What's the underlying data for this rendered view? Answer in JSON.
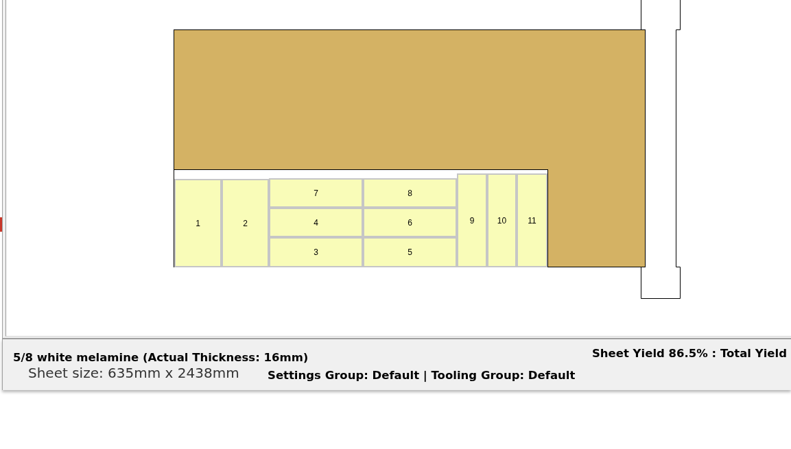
{
  "nesting_view": {
    "sheet": {
      "parts": [
        {
          "label": "1"
        },
        {
          "label": "2"
        },
        {
          "label": "7"
        },
        {
          "label": "4"
        },
        {
          "label": "3"
        },
        {
          "label": "8"
        },
        {
          "label": "6"
        },
        {
          "label": "5"
        },
        {
          "label": "9"
        },
        {
          "label": "10"
        },
        {
          "label": "11"
        }
      ]
    }
  },
  "status_bar": {
    "material": "5/8 white melamine (Actual Thickness: 16mm)",
    "yield": "Sheet Yield 86.5% : Total Yield",
    "sheet_size": "Sheet size: 635mm x 2438mm",
    "groups": "Settings Group: Default | Tooling Group: Default"
  }
}
